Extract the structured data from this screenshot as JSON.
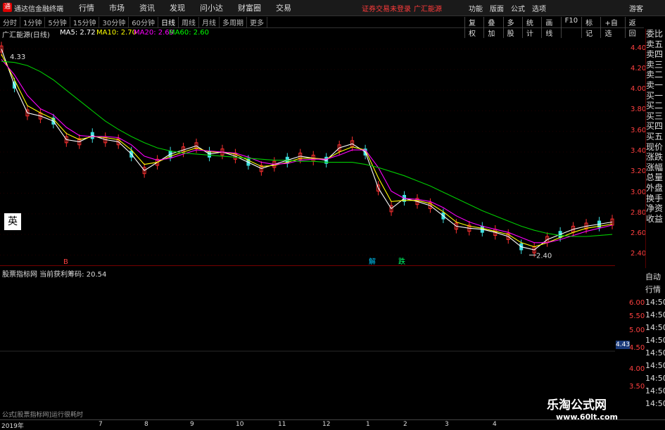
{
  "titlebar": {
    "app_title": "通达信金融终端",
    "menu": [
      "行情",
      "市场",
      "资讯",
      "发现",
      "问小达",
      "财富圈",
      "交易"
    ],
    "notice": "证券交易未登录",
    "stock": "广汇能源",
    "right_menu": [
      "功能",
      "版面",
      "公式",
      "选项"
    ],
    "guest": "游客"
  },
  "toolbar": {
    "periods": [
      "分时",
      "1分钟",
      "5分钟",
      "15分钟",
      "30分钟",
      "60分钟",
      "日线",
      "周线",
      "月线",
      "多周期",
      "更多"
    ],
    "active_period": "日线",
    "right_tools": [
      "复权",
      "叠加",
      "多股",
      "统计",
      "画线",
      "F10",
      "标记",
      "+自选",
      "返回"
    ]
  },
  "price_header": {
    "name": "广汇能源(日线)",
    "ma": [
      {
        "label": "MA5: 2.72",
        "color": "#ffffff"
      },
      {
        "label": "MA10: 2.70",
        "color": "#ffff00"
      },
      {
        "label": "MA20: 2.69",
        "color": "#ff00ff"
      },
      {
        "label": "MA60: 2.60",
        "color": "#00ff00"
      }
    ]
  },
  "y_axis_main": [
    "4.40",
    "4.20",
    "4.00",
    "3.80",
    "3.60",
    "3.40",
    "3.20",
    "3.00",
    "2.80",
    "2.60",
    "2.40"
  ],
  "annotations": {
    "high": "4.33",
    "low": "2.40"
  },
  "markers": [
    {
      "text": "B",
      "color": "#ff4040"
    },
    {
      "text": "解",
      "color": "#00ccff"
    },
    {
      "text": "跌",
      "color": "#00ff66"
    }
  ],
  "ying_label": "英",
  "right_list_top": [
    "委比",
    "卖五",
    "卖四",
    "卖三",
    "卖二",
    "卖一",
    "买一",
    "买二",
    "买三",
    "买四",
    "买五",
    "现价",
    "涨跌",
    "涨幅",
    "总量",
    "外盘",
    "换手",
    "净资",
    "收益"
  ],
  "sub_header": {
    "label": "股票指标网 当前获利筹码:",
    "value": "20.54"
  },
  "y_axis_sub": [
    "6.00",
    "5.50",
    "5.00",
    "4.50",
    "4.00",
    "3.50"
  ],
  "sub_indicator_value": "4.43",
  "right_list_bottom": [
    "自动",
    "行情",
    "14:50",
    "14:50",
    "14:50",
    "14:50",
    "14:50",
    "14:50",
    "14:50",
    "14:50",
    "14:50"
  ],
  "formula_text": "公式[股票指标网]运行很耗时",
  "x_axis": [
    "2019年",
    "7",
    "8",
    "9",
    "10",
    "11",
    "12",
    "1",
    "2",
    "3",
    "4"
  ],
  "watermark": {
    "line1": "乐淘公式网",
    "line2": "www.60lt.com"
  },
  "chart_data": {
    "type": "line",
    "title": "广汇能源(日线)",
    "xlabel": "",
    "ylabel": "",
    "ylim": [
      2.3,
      4.5
    ],
    "x": [
      0,
      5,
      10,
      15,
      20,
      25,
      30,
      35,
      40,
      45,
      50,
      55,
      60,
      65,
      70,
      75,
      80,
      85,
      90,
      95,
      100,
      105,
      110,
      115,
      120,
      125,
      130,
      135,
      140,
      145,
      150,
      155,
      160,
      165,
      170,
      175,
      180,
      185,
      190,
      195,
      200,
      205,
      210,
      215,
      220,
      225,
      230,
      235
    ],
    "series": [
      {
        "name": "MA5",
        "color": "#ffffff",
        "values": [
          4.4,
          4.05,
          3.78,
          3.75,
          3.7,
          3.52,
          3.5,
          3.56,
          3.52,
          3.5,
          3.38,
          3.22,
          3.3,
          3.38,
          3.42,
          3.46,
          3.38,
          3.4,
          3.36,
          3.3,
          3.24,
          3.28,
          3.32,
          3.36,
          3.34,
          3.32,
          3.44,
          3.48,
          3.4,
          3.05,
          2.85,
          2.95,
          2.92,
          2.88,
          2.78,
          2.68,
          2.66,
          2.65,
          2.62,
          2.58,
          2.48,
          2.45,
          2.55,
          2.6,
          2.65,
          2.68,
          2.7,
          2.72
        ]
      },
      {
        "name": "MA10",
        "color": "#ffff00",
        "values": [
          4.35,
          4.1,
          3.85,
          3.78,
          3.72,
          3.58,
          3.52,
          3.55,
          3.54,
          3.52,
          3.42,
          3.28,
          3.3,
          3.36,
          3.4,
          3.44,
          3.4,
          3.4,
          3.38,
          3.32,
          3.26,
          3.27,
          3.3,
          3.34,
          3.34,
          3.33,
          3.4,
          3.45,
          3.42,
          3.15,
          2.92,
          2.93,
          2.93,
          2.9,
          2.82,
          2.72,
          2.68,
          2.66,
          2.63,
          2.6,
          2.52,
          2.48,
          2.52,
          2.57,
          2.62,
          2.66,
          2.68,
          2.7
        ]
      },
      {
        "name": "MA20",
        "color": "#ff00ff",
        "values": [
          4.3,
          4.15,
          3.95,
          3.82,
          3.76,
          3.64,
          3.56,
          3.55,
          3.55,
          3.54,
          3.47,
          3.36,
          3.32,
          3.34,
          3.38,
          3.42,
          3.41,
          3.4,
          3.39,
          3.35,
          3.3,
          3.28,
          3.29,
          3.32,
          3.33,
          3.33,
          3.37,
          3.42,
          3.42,
          3.25,
          3.02,
          2.95,
          2.94,
          2.92,
          2.86,
          2.78,
          2.72,
          2.68,
          2.65,
          2.62,
          2.57,
          2.52,
          2.52,
          2.55,
          2.59,
          2.63,
          2.66,
          2.69
        ]
      },
      {
        "name": "MA60",
        "color": "#00cc00",
        "values": [
          4.28,
          4.27,
          4.24,
          4.18,
          4.1,
          4.0,
          3.9,
          3.8,
          3.7,
          3.62,
          3.55,
          3.49,
          3.44,
          3.41,
          3.39,
          3.38,
          3.37,
          3.36,
          3.35,
          3.34,
          3.33,
          3.32,
          3.32,
          3.31,
          3.31,
          3.3,
          3.3,
          3.3,
          3.28,
          3.25,
          3.21,
          3.17,
          3.12,
          3.07,
          3.01,
          2.95,
          2.89,
          2.83,
          2.78,
          2.73,
          2.68,
          2.64,
          2.61,
          2.59,
          2.58,
          2.58,
          2.59,
          2.6
        ]
      }
    ]
  }
}
